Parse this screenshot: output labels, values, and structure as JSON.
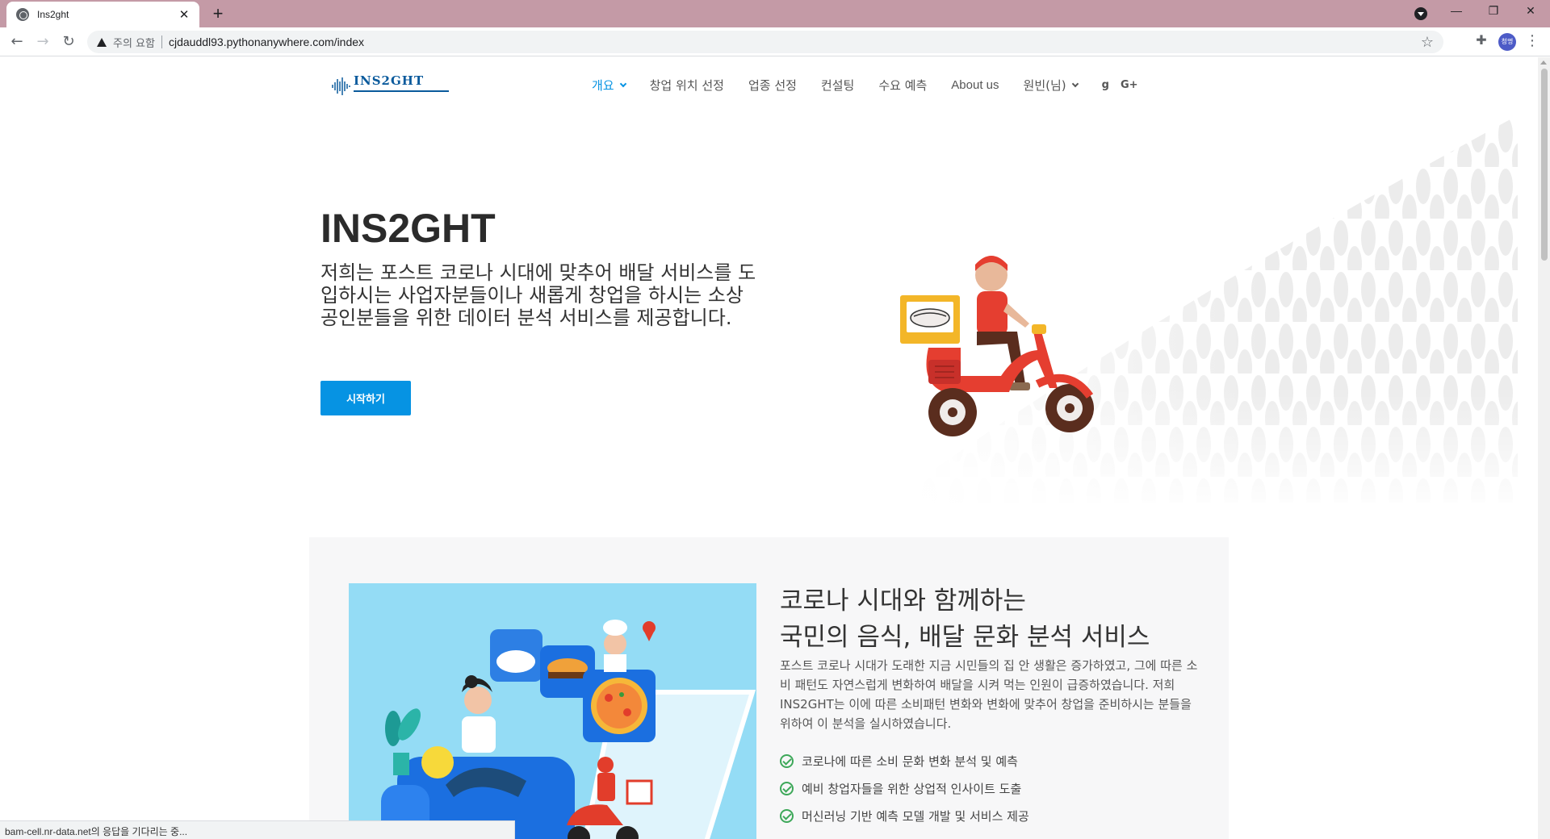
{
  "browser": {
    "tab_title": "Ins2ght",
    "new_tab": "+",
    "security_warning": "주의 요함",
    "url": "cjdauddl93.pythonanywhere.com/index",
    "profile_initials": "청명",
    "status_text": "bam-cell.nr-data.net의 응답을 기다리는 중..."
  },
  "site": {
    "logo_text": "INS2GHT",
    "nav": [
      {
        "label": "개요",
        "has_caret": true,
        "active": true
      },
      {
        "label": "창업 위치 선정"
      },
      {
        "label": "업종 선정"
      },
      {
        "label": "컨설팅"
      },
      {
        "label": "수요 예측"
      },
      {
        "label": "About us"
      },
      {
        "label": "원빈(님)",
        "has_caret": true
      }
    ],
    "social": [
      "g",
      "G+"
    ]
  },
  "hero": {
    "title": "INS2GHT",
    "description": "저희는 포스트 코로나 시대에 맞추어 배달 서비스를 도입하시는 사업자분들이나 새롭게 창업을 하시는 소상공인분들을 위한 데이터 분석 서비스를 제공합니다.",
    "cta_label": "시작하기"
  },
  "feature": {
    "title_line1": "코로나 시대와 함께하는",
    "title_line2": "국민의 음식, 배달 문화 분석 서비스",
    "description": "포스트 코로나 시대가 도래한 지금 시민들의 집 안 생활은 증가하였고, 그에 따른 소비 패턴도 자연스럽게 변화하여 배달을 시켜 먹는 인원이 급증하였습니다. 저희 INS2GHT는 이에 따른 소비패턴 변화와 변화에 맞추어 창업을 준비하시는 분들을 위하여 이 분석을 실시하였습니다.",
    "items": [
      "코로나에 따른 소비 문화 변화 분석 및 예측",
      "예비 창업자들을 위한 상업적 인사이트 도출",
      "머신러닝 기반 예측 모델 개발 및 서비스 제공"
    ]
  },
  "colors": {
    "accent": "#0693e3",
    "tabstrip": "#c49aa6",
    "check": "#3ea85a",
    "feature_img_bg": "#94dcf5"
  }
}
